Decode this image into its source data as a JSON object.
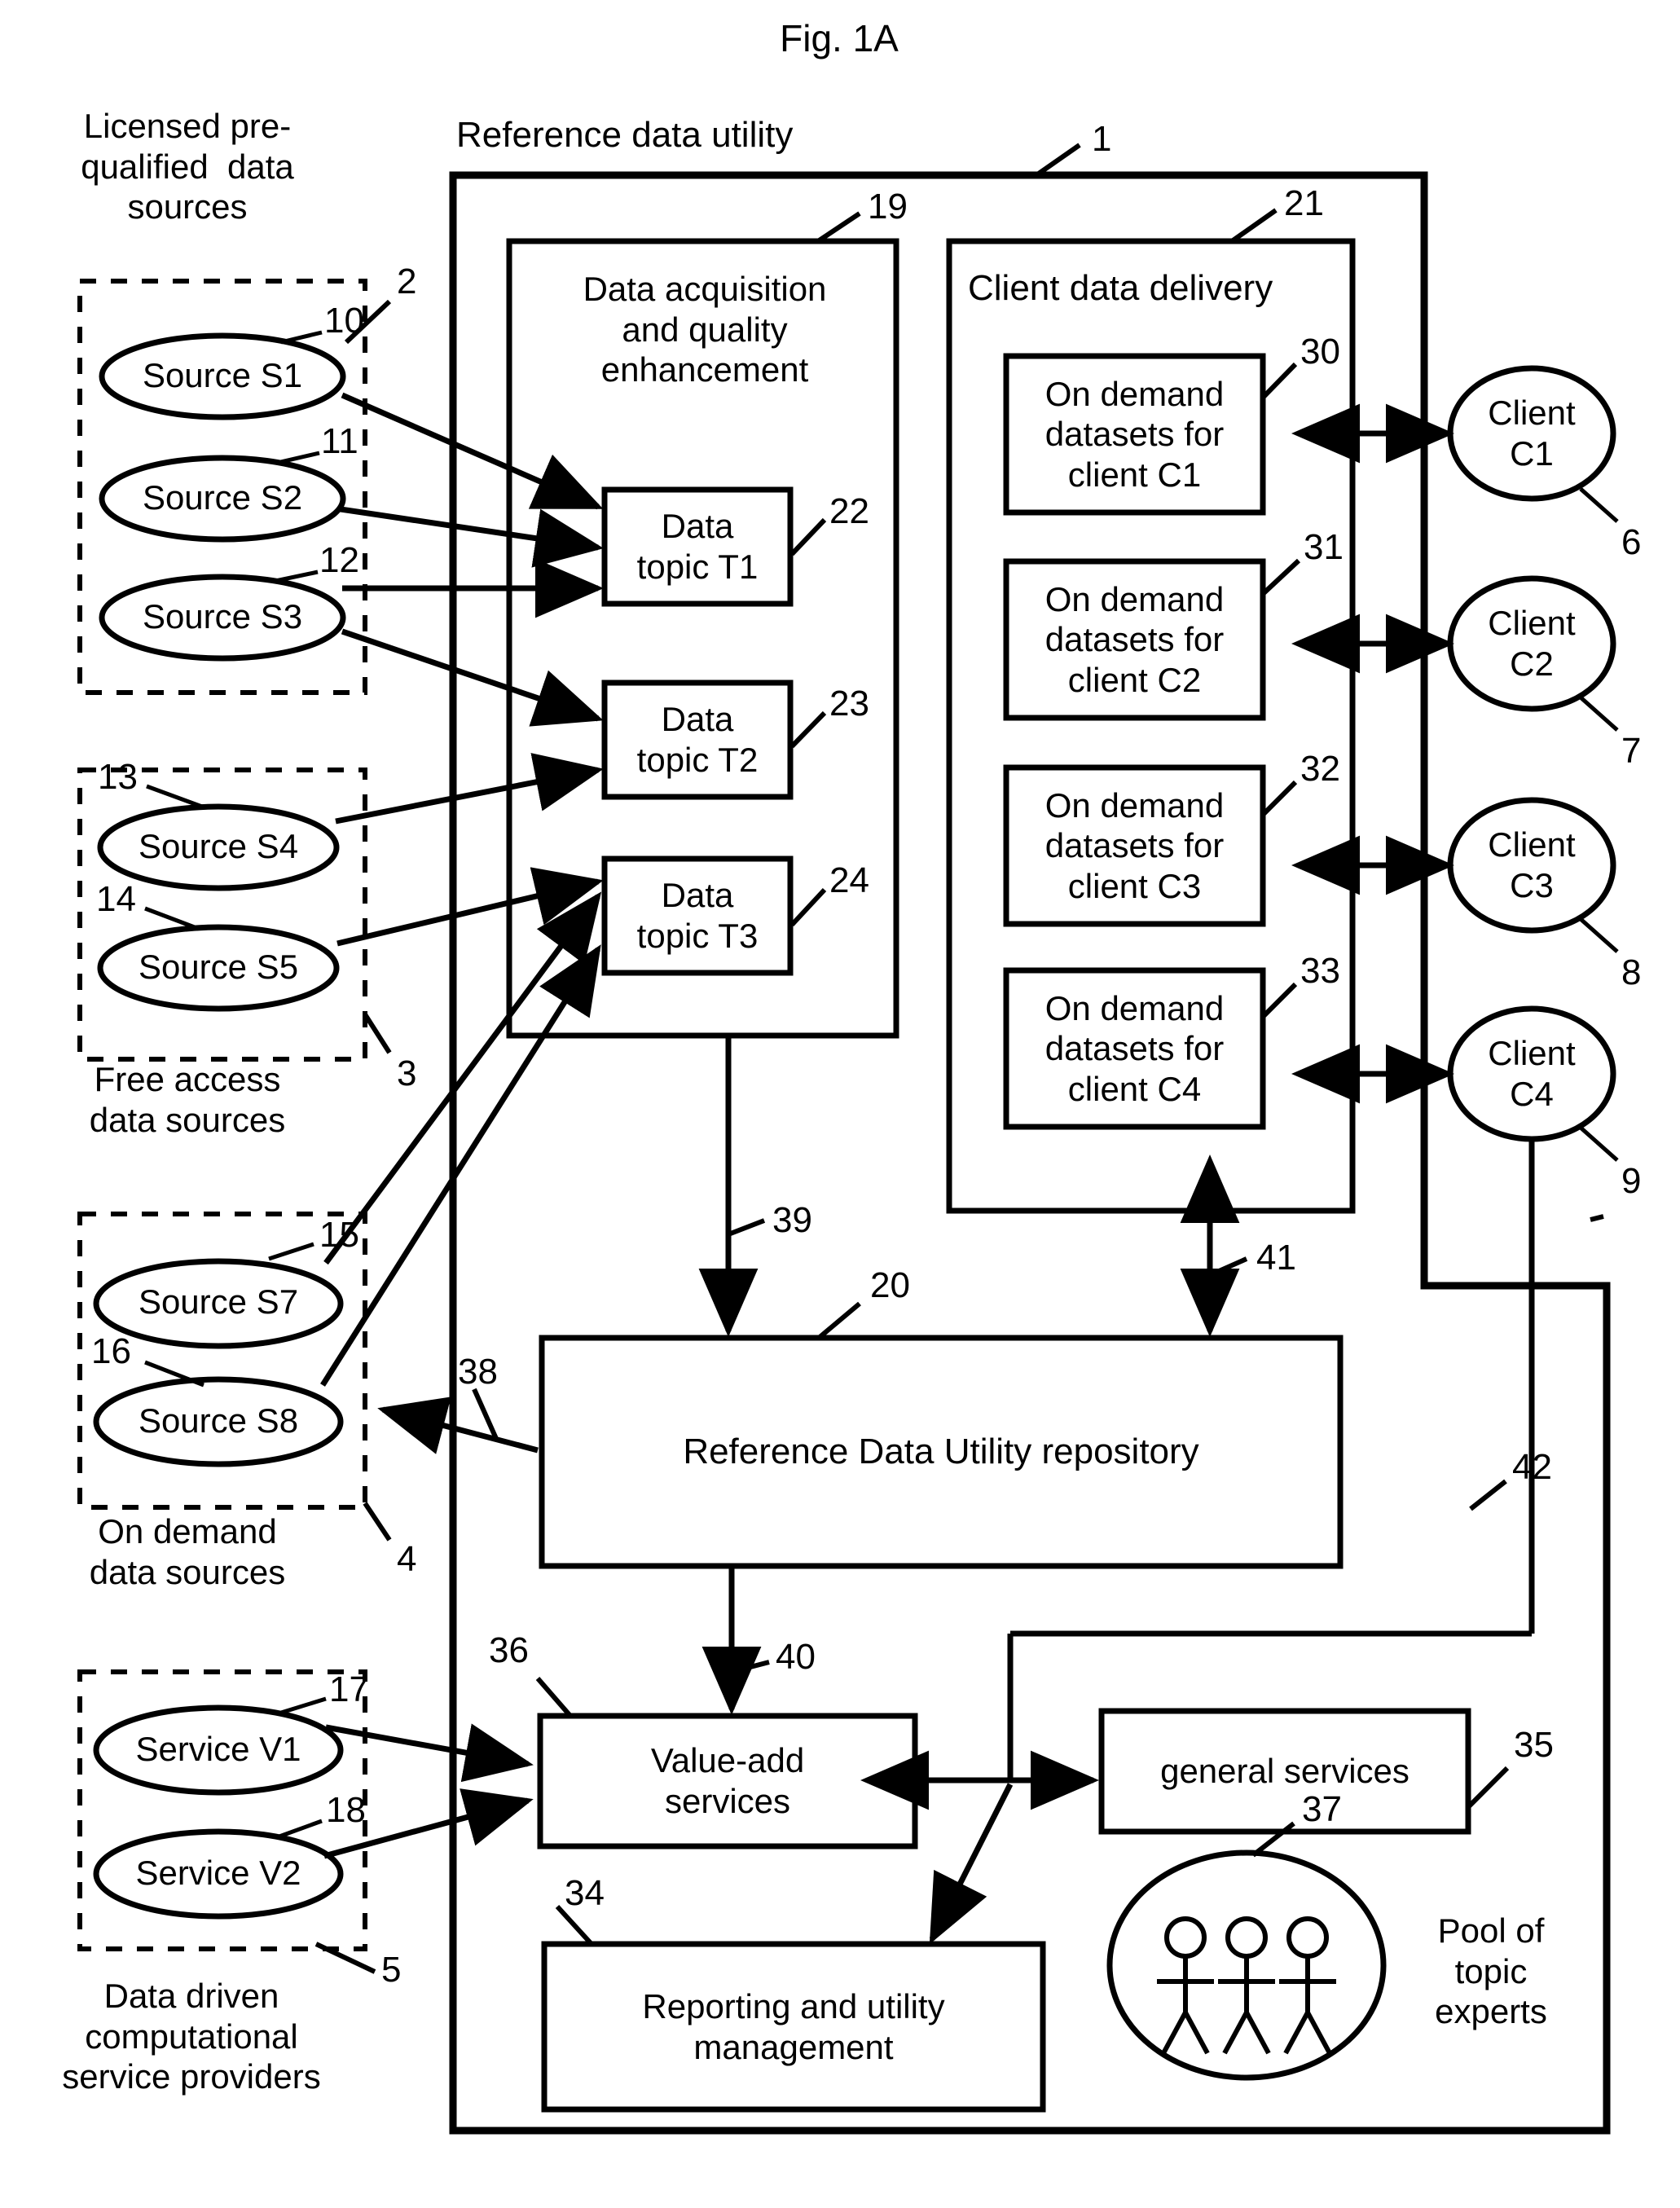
{
  "figure": {
    "title": "Fig. 1A"
  },
  "outer_labels": {
    "licensed": "Licensed pre-\nqualified  data\nsources",
    "free_access": "Free access\ndata sources",
    "on_demand": "On demand\ndata sources",
    "computational": "Data driven\ncomputational\nservice providers",
    "pool_of_experts": "Pool of\ntopic\nexperts"
  },
  "main_frame": {
    "title": "Reference data utility",
    "ref": "1"
  },
  "acquisition_panel": {
    "title": "Data acquisition\nand quality\nenhancement",
    "ref": "19",
    "topics": [
      {
        "label": "Data\ntopic T1",
        "ref": "22"
      },
      {
        "label": "Data\ntopic T2",
        "ref": "23"
      },
      {
        "label": "Data\ntopic T3",
        "ref": "24"
      }
    ]
  },
  "delivery_panel": {
    "title": "Client data delivery",
    "ref": "21",
    "datasets": [
      {
        "label": "On demand\ndatasets for\nclient C1",
        "ref": "30"
      },
      {
        "label": "On demand\ndatasets for\nclient C2",
        "ref": "31"
      },
      {
        "label": "On demand\ndatasets for\nclient C3",
        "ref": "32"
      },
      {
        "label": "On demand\ndatasets for\nclient C4",
        "ref": "33"
      }
    ]
  },
  "clients": [
    {
      "label": "Client\nC1",
      "ref": "6"
    },
    {
      "label": "Client\nC2",
      "ref": "7"
    },
    {
      "label": "Client\nC3",
      "ref": "8"
    },
    {
      "label": "Client\nC4",
      "ref": "9"
    }
  ],
  "source_groups": [
    {
      "ref": "2",
      "sources": [
        {
          "label": "Source S1",
          "ref": "10"
        },
        {
          "label": "Source S2",
          "ref": "11"
        },
        {
          "label": "Source S3",
          "ref": "12"
        }
      ]
    },
    {
      "ref": "3",
      "sources": [
        {
          "label": "Source S4",
          "ref": "13"
        },
        {
          "label": "Source S5",
          "ref": "14"
        }
      ]
    },
    {
      "ref": "4",
      "sources": [
        {
          "label": "Source S7",
          "ref": "15"
        },
        {
          "label": "Source S8",
          "ref": "16"
        }
      ]
    },
    {
      "ref": "5",
      "sources": [
        {
          "label": "Service V1",
          "ref": "17"
        },
        {
          "label": "Service V2",
          "ref": "18"
        }
      ]
    }
  ],
  "repository": {
    "label": "Reference Data Utility repository",
    "ref": "20"
  },
  "value_add": {
    "label": "Value-add\nservices",
    "ref": "36"
  },
  "general_services": {
    "label": "general services",
    "ref": "35"
  },
  "reporting": {
    "label": "Reporting and utility\nmanagement",
    "ref": "34"
  },
  "experts": {
    "ref": "37"
  },
  "connector_refs": {
    "repo_to_sources": "38",
    "acq_to_repo": "39",
    "repo_to_valueadd": "40",
    "repo_to_delivery": "41",
    "client_feedback": "42"
  }
}
